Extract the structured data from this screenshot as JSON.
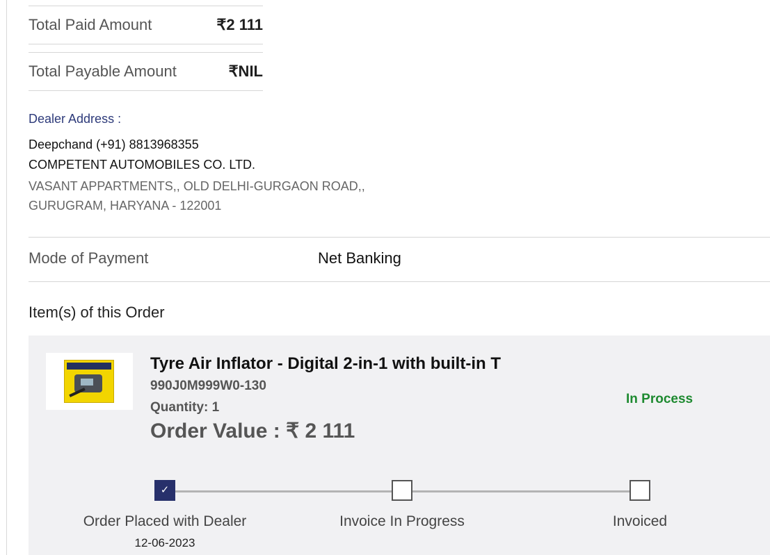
{
  "summary": {
    "paid_label": "Total Paid Amount",
    "paid_value": "₹2 111",
    "payable_label": "Total Payable Amount",
    "payable_value": "₹NIL"
  },
  "dealer": {
    "heading": "Dealer Address :",
    "contact": "Deepchand (+91) 8813968355",
    "company": "COMPETENT AUTOMOBILES CO. LTD.",
    "address_line1": "VASANT APPARTMENTS,, OLD DELHI-GURGAON ROAD,,",
    "address_line2": "GURUGRAM, HARYANA - 122001"
  },
  "payment": {
    "label": "Mode of Payment",
    "value": "Net Banking"
  },
  "items_heading": "Item(s) of this Order",
  "item": {
    "title": "Tyre Air Inflator - Digital 2-in-1 with built-in T",
    "sku": "990J0M999W0-130",
    "quantity": "Quantity: 1",
    "order_value": "Order Value : ₹ 2 111",
    "status": "In Process",
    "status_color": "#1e8a30",
    "image_icon": "product-box-icon"
  },
  "progress": {
    "steps": [
      {
        "label": "Order Placed with Dealer",
        "date": "12-06-2023",
        "state": "complete"
      },
      {
        "label": "Invoice In Progress",
        "state": "pending"
      },
      {
        "label": "Invoiced",
        "state": "pending"
      }
    ],
    "accent_color": "#27306b"
  }
}
